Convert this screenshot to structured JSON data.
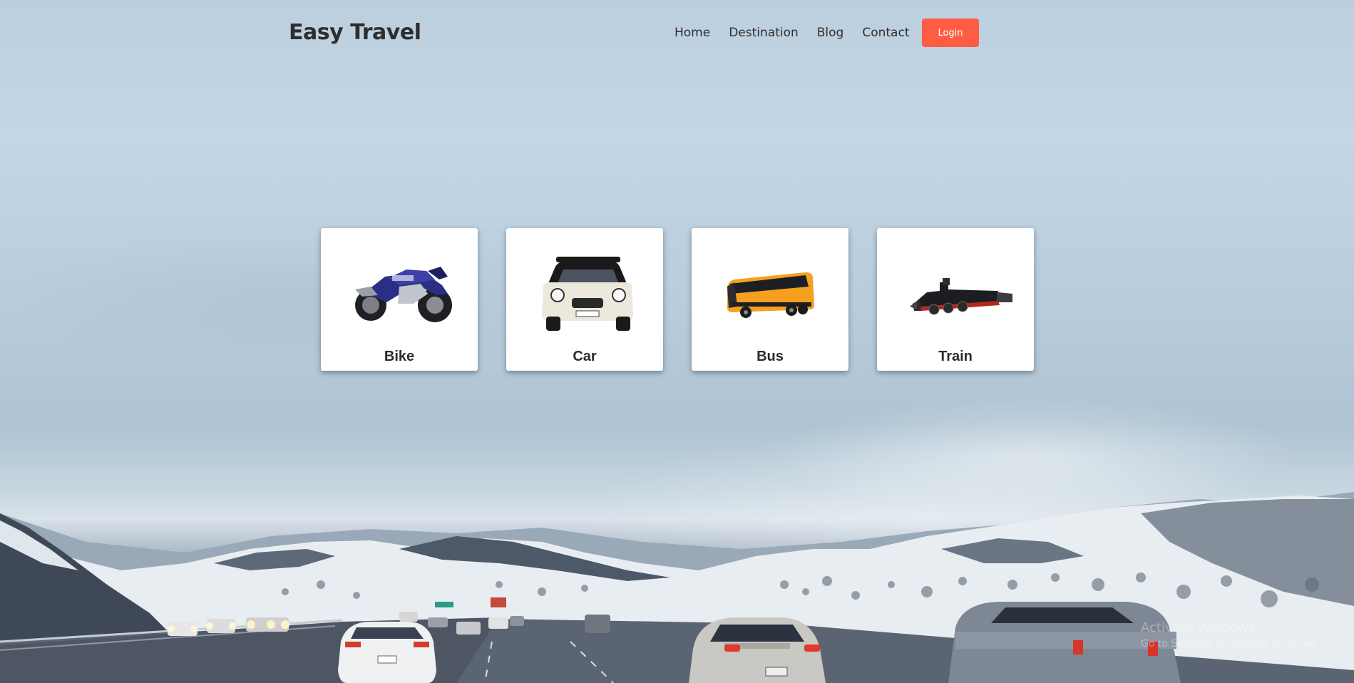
{
  "brand": {
    "title": "Easy Travel"
  },
  "nav": {
    "links": [
      "Home",
      "Destination",
      "Blog",
      "Contact"
    ],
    "login_label": "Login"
  },
  "cards": [
    {
      "label": "Bike",
      "icon": "motorcycle-icon"
    },
    {
      "label": "Car",
      "icon": "car-icon"
    },
    {
      "label": "Bus",
      "icon": "bus-icon"
    },
    {
      "label": "Train",
      "icon": "train-icon"
    }
  ],
  "watermark": {
    "line1": "Activate Windows",
    "line2": "Go to Settings to activate Windows."
  },
  "colors": {
    "accent": "#ff5c44",
    "card_bg": "#ffffff",
    "text": "#2e2e2e"
  }
}
